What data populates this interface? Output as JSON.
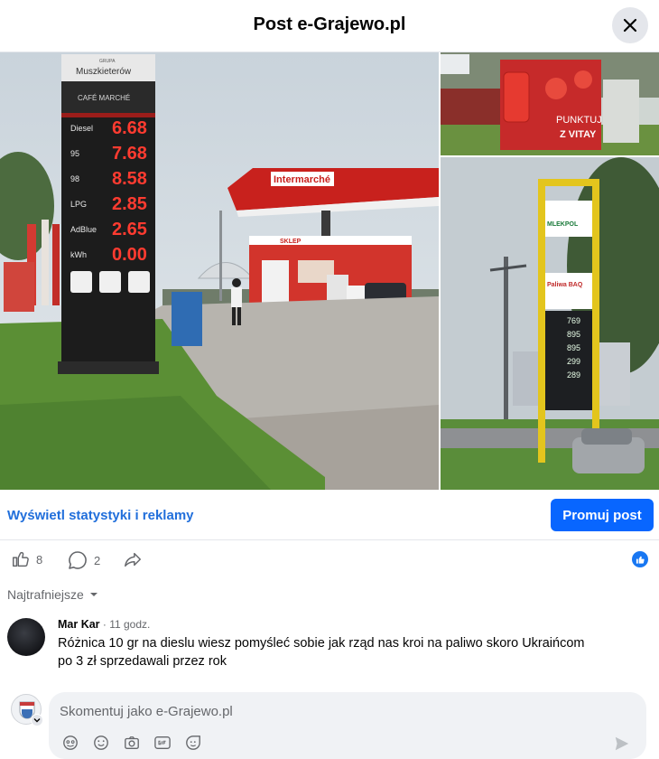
{
  "header": {
    "title": "Post e-Grajewo.pl"
  },
  "photos": {
    "main": {
      "brand_group": "GRUPA",
      "brand_name": "Muszkieterów",
      "cafe": "CAFÉ MARCHÉ",
      "station_brand": "Intermarché",
      "shop": "SKLEP",
      "prices": [
        {
          "fuel": "Diesel",
          "price": "6.68"
        },
        {
          "fuel": "95",
          "price": "7.68"
        },
        {
          "fuel": "98",
          "price": "8.58"
        },
        {
          "fuel": "LPG",
          "price": "2.85"
        },
        {
          "fuel": "AdBlue",
          "price": "2.65"
        },
        {
          "fuel": "kWh",
          "price": "0.00"
        }
      ]
    },
    "top_right": {
      "line1": "PUNKTUJ",
      "line2": "Z VITAY"
    },
    "bottom_right": {
      "brand": "MLEKPOL",
      "sub_brand": "Paliwa BAQ",
      "prices": [
        "769",
        "895",
        "895",
        "299",
        "289"
      ]
    }
  },
  "actions": {
    "stats_link": "Wyświetl statystyki i reklamy",
    "promote": "Promuj post"
  },
  "reactions": {
    "likes": "8",
    "comments": "2"
  },
  "sort": {
    "label": "Najtrafniejsze"
  },
  "comment": {
    "author": "Mar Kar",
    "separator": " · ",
    "time": "11 godz.",
    "text": "Różnica 10 gr na dieslu wiesz pomyśleć sobie jak rząd nas kroi na paliwo skoro Ukraińcom po 3 zł sprzedawali przez rok"
  },
  "composer": {
    "placeholder": "Skomentuj jako e-Grajewo.pl"
  },
  "colors": {
    "accent": "#0866ff",
    "link": "#216fdb",
    "price_red": "#ff3b30",
    "price_green": "#e9ffe9"
  }
}
